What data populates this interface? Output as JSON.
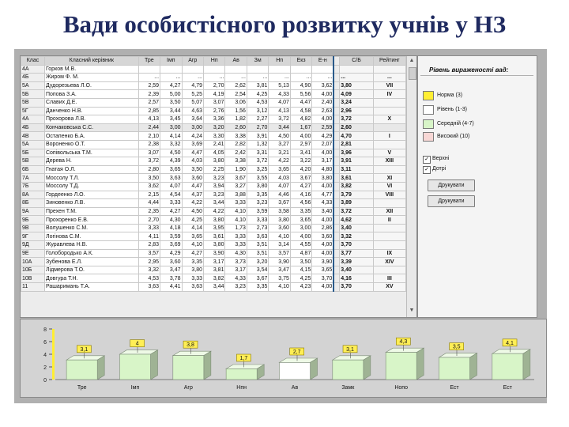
{
  "slide": {
    "title": "Вади особистісного розвитку учнів у НЗ"
  },
  "table": {
    "columns": [
      "Клас",
      "Класний керівник",
      "Тре",
      "Імп",
      "Агр",
      "Нп",
      "Ав",
      "Зм",
      "Нп",
      "Екз",
      "Е-н",
      "С/Б",
      "Рейтинг"
    ],
    "rows": [
      [
        "4А",
        "Горков М.В.",
        "",
        "",
        "",
        "",
        "",
        "",
        "",
        "",
        "",
        "",
        ""
      ],
      [
        "4Б",
        "Жиром Ф. М.",
        "...",
        "...",
        "...",
        "...",
        "...",
        "...",
        "...",
        "...",
        "...",
        "...",
        "..."
      ],
      [
        "5А",
        "Дудорезьева Л.О.",
        "2,59",
        "4,27",
        "4,79",
        "2,70",
        "2,62",
        "3,81",
        "5,13",
        "4,90",
        "3,62",
        "3,80",
        "VII"
      ],
      [
        "5Б",
        "Попова З.А.",
        "2,39",
        "5,00",
        "5,25",
        "4,19",
        "2,54",
        "4,25",
        "4,33",
        "5,56",
        "4,00",
        "4,09",
        "IV"
      ],
      [
        "5В",
        "Славих Д.Е.",
        "2,57",
        "3,50",
        "5,07",
        "3,07",
        "3,06",
        "4,53",
        "4,07",
        "4,47",
        "2,40",
        "3,24",
        ""
      ],
      [
        "5Г",
        "Данченко Н.В.",
        "2,85",
        "3,44",
        "4,63",
        "2,76",
        "1,56",
        "3,12",
        "4,13",
        "4,58",
        "2,63",
        "2,96",
        ""
      ],
      [
        "4А",
        "Прохорова Л.В.",
        "4,13",
        "3,45",
        "3,64",
        "3,36",
        "1,82",
        "2,27",
        "3,72",
        "4,82",
        "4,00",
        "3,72",
        "X"
      ],
      [
        "4Б",
        "Кончаковська С.С.",
        "2,44",
        "3,00",
        "3,00",
        "3,20",
        "2,60",
        "2,70",
        "3,44",
        "1,67",
        "2,59",
        "2,60",
        ""
      ],
      [
        "4В",
        "Остапенко Б.А.",
        "2,10",
        "4,14",
        "4,24",
        "3,30",
        "3,38",
        "3,91",
        "4,50",
        "4,00",
        "4,29",
        "4,70",
        "I"
      ],
      [
        "5А",
        "Вороненко О.Т.",
        "2,38",
        "3,32",
        "3,69",
        "2,41",
        "2,82",
        "1,32",
        "3,27",
        "2,97",
        "2,07",
        "2,81",
        ""
      ],
      [
        "5Б",
        "Сопівольська Т.М.",
        "3,07",
        "4,50",
        "4,47",
        "4,05",
        "2,42",
        "3,31",
        "3,21",
        "3,41",
        "4,00",
        "3,96",
        "V"
      ],
      [
        "5В",
        "Дерева Н.",
        "3,72",
        "4,39",
        "4,03",
        "3,80",
        "3,38",
        "3,72",
        "4,22",
        "3,22",
        "3,17",
        "3,91",
        "XIII"
      ],
      [
        "6Б",
        "Гнатая О.Л.",
        "2,80",
        "3,65",
        "3,50",
        "2,25",
        "1,90",
        "3,25",
        "3,65",
        "4,20",
        "4,80",
        "3,11",
        ""
      ],
      [
        "7А",
        "Моссолу Т.Л.",
        "3,50",
        "3,63",
        "3,60",
        "3,23",
        "3,67",
        "3,55",
        "4,03",
        "3,67",
        "3,80",
        "3,61",
        "XI"
      ],
      [
        "7Б",
        "Моссолу Т.Д.",
        "3,62",
        "4,07",
        "4,47",
        "3,94",
        "3,27",
        "3,80",
        "4,07",
        "4,27",
        "4,00",
        "3,82",
        "VI"
      ],
      [
        "8А",
        "Гордеенко Л.О.",
        "2,15",
        "4,54",
        "4,37",
        "3,23",
        "3,88",
        "3,35",
        "4,46",
        "4,16",
        "4,77",
        "3,79",
        "VIII"
      ],
      [
        "8Б",
        "Зиновенко Л.В.",
        "4,44",
        "3,33",
        "4,22",
        "3,44",
        "3,33",
        "3,23",
        "3,67",
        "4,56",
        "4,33",
        "3,89",
        ""
      ],
      [
        "9А",
        "Прехен Т.М.",
        "2,35",
        "4,27",
        "4,50",
        "4,22",
        "4,10",
        "3,59",
        "3,58",
        "3,35",
        "3,40",
        "3,72",
        "XII"
      ],
      [
        "9Б",
        "Прохоренко Е.В.",
        "2,70",
        "4,30",
        "4,25",
        "3,80",
        "4,10",
        "3,33",
        "3,80",
        "3,65",
        "4,00",
        "4,62",
        "II"
      ],
      [
        "9В",
        "Волушенко С.М.",
        "3,33",
        "4,18",
        "4,14",
        "3,95",
        "1,73",
        "2,73",
        "3,60",
        "3,00",
        "2,86",
        "3,40",
        ""
      ],
      [
        "9Г",
        "Логінова С.М.",
        "4,11",
        "3,59",
        "3,65",
        "3,61",
        "3,33",
        "3,63",
        "4,10",
        "4,00",
        "3,60",
        "3,32",
        ""
      ],
      [
        "9Д",
        "Журавлева Н.В.",
        "2,83",
        "3,69",
        "4,10",
        "3,80",
        "3,33",
        "3,51",
        "3,14",
        "4,55",
        "4,00",
        "3,70",
        ""
      ],
      [
        "9Е",
        "Голобородько А.К.",
        "3,57",
        "4,29",
        "4,27",
        "3,90",
        "4,30",
        "3,51",
        "3,57",
        "4,87",
        "4,00",
        "3,77",
        "IX"
      ],
      [
        "10А",
        "Зубенова Е.Л.",
        "2,95",
        "3,60",
        "3,35",
        "3,17",
        "3,73",
        "3,20",
        "3,90",
        "3,50",
        "3,90",
        "3,39",
        "XIV"
      ],
      [
        "10Б",
        "Лідмерова Т.О.",
        "3,32",
        "3,47",
        "3,80",
        "3,81",
        "3,17",
        "3,54",
        "3,47",
        "4,15",
        "3,65",
        "3,40",
        ""
      ],
      [
        "10В",
        "Довгура Т.Н.",
        "4,53",
        "3,78",
        "3,33",
        "3,82",
        "4,33",
        "3,67",
        "3,75",
        "4,25",
        "3,70",
        "4,16",
        "III"
      ],
      [
        "11",
        "Рашаримань Т.А.",
        "3,63",
        "4,41",
        "3,63",
        "3,44",
        "3,23",
        "3,35",
        "4,10",
        "4,23",
        "4,00",
        "3,70",
        "XV"
      ]
    ],
    "selected_row": 7
  },
  "legend": {
    "title": "Рівень вираженості вад:",
    "items": [
      {
        "label": "Норма (3)",
        "color": "#ffee33"
      },
      {
        "label": "Рівень (1-3)",
        "color": "#ffffff"
      },
      {
        "label": "Середній (4-7)",
        "color": "#d8f5c8"
      },
      {
        "label": "Високий (10)",
        "color": "#f7d7d5"
      }
    ],
    "checkboxes": [
      {
        "label": "Верхні",
        "checked": true
      },
      {
        "label": "Дотрі",
        "checked": true
      }
    ],
    "buttons": [
      "Друкувати",
      "Друкувати"
    ]
  },
  "chart_data": {
    "type": "bar",
    "categories": [
      "Тре",
      "Імп",
      "Агр",
      "Нпн",
      "Ав",
      "Замк",
      "Нопо",
      "Ест",
      "Ест"
    ],
    "values": [
      3.1,
      4,
      3.8,
      1.7,
      2.7,
      3.1,
      4.3,
      3.5,
      4.1
    ],
    "labels": [
      "3,1",
      "4",
      "3,8",
      "1,7",
      "2,7",
      "3,1",
      "4,3",
      "3,5",
      "4,1"
    ],
    "ylim": [
      0,
      8
    ],
    "yticks": [
      0,
      2,
      4,
      6,
      8
    ],
    "bar_color": "#d8f5c8",
    "highlight_color": "#ffffff",
    "highlight_index": 4,
    "label_color": "#ffee55",
    "axis_stripe_color": "#ffee33"
  }
}
